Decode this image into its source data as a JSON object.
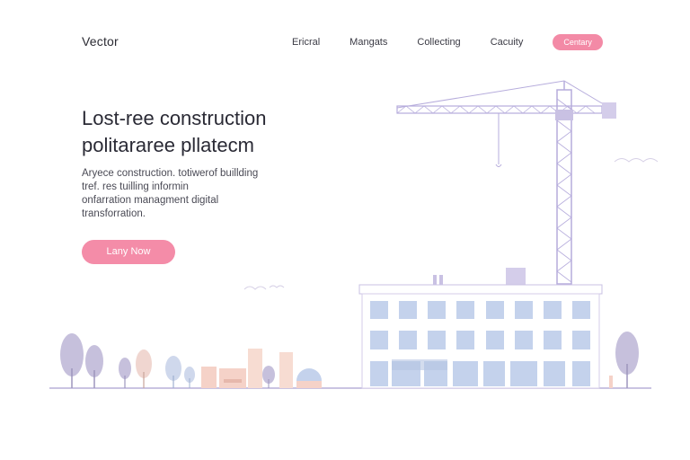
{
  "brand": {
    "logo_text": "Vector"
  },
  "nav": {
    "links": [
      "Ericral",
      "Mangats",
      "Collecting",
      "Cacuity"
    ],
    "cta_label": "Centary"
  },
  "hero": {
    "title_lines": [
      "Lost-ree construction",
      "politararee pllatecm"
    ],
    "description_lines": [
      "Aryece construction. totiwerof buillding",
      "tref. res tuilling informin",
      "onfarration managment digital",
      "transforration."
    ],
    "button_label": "Lany Now"
  },
  "colors": {
    "accent_pink": "#f48ca8",
    "crane_lavender": "#b6acdc",
    "window_blue": "#c4d2ec",
    "ground_line": "#b9b0d8",
    "tree_lavender": "#c6c0dc",
    "city_peach": "#f5d2c8"
  },
  "illustration": {
    "name": "tower-crane-over-office-building",
    "elements": [
      "tower-crane",
      "office-building",
      "trees",
      "small-city-buildings",
      "birds"
    ]
  }
}
